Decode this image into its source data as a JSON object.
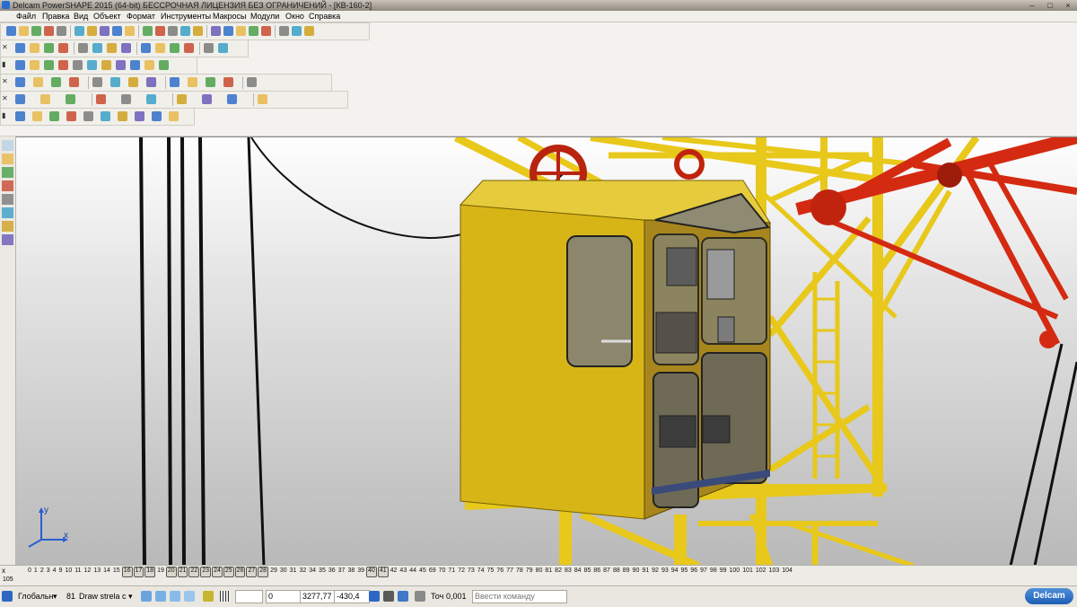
{
  "window": {
    "title": "Delcam PowerSHAPE 2015 (64-bit) БЕССРОЧНАЯ ЛИЦЕНЗИЯ БЕЗ ОГРАНИЧЕНИЙ - [КВ-160-2]",
    "minimize": "–",
    "maximize": "□",
    "close": "×"
  },
  "menu": [
    "Файл",
    "Правка",
    "Вид",
    "Объект",
    "Формат",
    "Инструменты",
    "Макросы",
    "Модули",
    "Окно",
    "Справка"
  ],
  "toolbars": {
    "row1": [
      "new-file-icon",
      "open-file-icon",
      "open-model-icon",
      "save-icon",
      "print-icon",
      "cut-icon",
      "copy-icon",
      "paste-icon",
      "erase-icon",
      "delete-icon",
      "undo-icon",
      "redo-icon",
      "select-icon",
      "wireframe-icon",
      "line-icon",
      "circle-icon",
      "curve-icon",
      "text-icon",
      "surface-icon",
      "solid-icon",
      "symbol-icon",
      "dimension-icon",
      "workplane-icon"
    ],
    "row1_colors": {
      "accent": "#2f6fc9",
      "active": "#a9c6ee"
    },
    "row2": [
      "view-iso-icon",
      "view-front-icon",
      "view-top-icon",
      "view-right-icon",
      "zoom-in-icon",
      "zoom-out-icon",
      "zoom-box-icon",
      "zoom-all-icon",
      "pan-icon",
      "rotate-icon",
      "shade-icon",
      "wireframe-view-icon",
      "light-icon",
      "material-icon"
    ],
    "row3": [
      "level-icon",
      "layer-icon",
      "colour-icon",
      "sphere-icon",
      "shade-smooth-icon",
      "arrow-green-icon",
      "cone-icon",
      "box-icon",
      "frame-icon",
      "block-icon",
      "texture-icon"
    ],
    "row4": [
      "curve-tools-icon",
      "surface-tools-icon",
      "fillet-icon",
      "blend-icon",
      "extrude-icon",
      "revolve-icon",
      "spine-icon",
      "sweep-icon",
      "loft-icon",
      "trim-icon",
      "limit-icon",
      "offset-icon",
      "edit-icon"
    ],
    "row5": [
      "solid-tools-icon",
      "boolean-icon",
      "feature-icon",
      "hole-icon",
      "chamfer-icon",
      "shell-icon",
      "draft-icon",
      "split-icon",
      "mirror-icon",
      "pattern-icon"
    ],
    "row6": [
      "render-icon",
      "axis-icon",
      "cube-icon",
      "cubes-icon",
      "block-stack-icon",
      "solid-cube-icon",
      "table-icon",
      "grid-icon",
      "palette-icon",
      "cone-render-icon"
    ]
  },
  "left_tools": [
    "pointer-icon",
    "axis-xy-icon",
    "axis-xyz-icon",
    "snap-icon",
    "measure-icon",
    "workplane-small-icon",
    "origin-icon",
    "star-icon"
  ],
  "viewport": {
    "axis_x": "x",
    "axis_y": "y",
    "colors": {
      "yellow": "#e8c81a",
      "dark_yellow": "#b8960a",
      "red": "#d42a12",
      "cabin": "#d7b517",
      "glass": "#8a8466"
    }
  },
  "layers": {
    "x_label": "x",
    "items": [
      {
        "n": "0",
        "on": false
      },
      {
        "n": "1",
        "on": false
      },
      {
        "n": "2",
        "on": false
      },
      {
        "n": "3",
        "on": false
      },
      {
        "n": "4",
        "on": false
      },
      {
        "n": "9",
        "on": false
      },
      {
        "n": "10",
        "on": false
      },
      {
        "n": "11",
        "on": false
      },
      {
        "n": "12",
        "on": false
      },
      {
        "n": "13",
        "on": false
      },
      {
        "n": "14",
        "on": false
      },
      {
        "n": "15",
        "on": false
      },
      {
        "n": "16",
        "on": true
      },
      {
        "n": "17",
        "on": true
      },
      {
        "n": "18",
        "on": true
      },
      {
        "n": "19",
        "on": false
      },
      {
        "n": "20",
        "on": true
      },
      {
        "n": "21",
        "on": true
      },
      {
        "n": "22",
        "on": true
      },
      {
        "n": "23",
        "on": true
      },
      {
        "n": "24",
        "on": true
      },
      {
        "n": "25",
        "on": true
      },
      {
        "n": "26",
        "on": true
      },
      {
        "n": "27",
        "on": true
      },
      {
        "n": "28",
        "on": true
      },
      {
        "n": "29",
        "on": false
      },
      {
        "n": "30",
        "on": false
      },
      {
        "n": "31",
        "on": false
      },
      {
        "n": "32",
        "on": false
      },
      {
        "n": "34",
        "on": false
      },
      {
        "n": "35",
        "on": false
      },
      {
        "n": "36",
        "on": false
      },
      {
        "n": "37",
        "on": false
      },
      {
        "n": "38",
        "on": false
      },
      {
        "n": "39",
        "on": false
      },
      {
        "n": "40",
        "on": true
      },
      {
        "n": "41",
        "on": true
      },
      {
        "n": "42",
        "on": false
      },
      {
        "n": "43",
        "on": false
      },
      {
        "n": "44",
        "on": false
      },
      {
        "n": "45",
        "on": false
      },
      {
        "n": "69",
        "on": false
      },
      {
        "n": "70",
        "on": false
      },
      {
        "n": "71",
        "on": false
      },
      {
        "n": "72",
        "on": false
      },
      {
        "n": "73",
        "on": false
      },
      {
        "n": "74",
        "on": false
      },
      {
        "n": "75",
        "on": false
      },
      {
        "n": "76",
        "on": false
      },
      {
        "n": "77",
        "on": false
      },
      {
        "n": "78",
        "on": false
      },
      {
        "n": "79",
        "on": false
      },
      {
        "n": "80",
        "on": false
      },
      {
        "n": "81",
        "on": false
      },
      {
        "n": "82",
        "on": false
      },
      {
        "n": "83",
        "on": false
      },
      {
        "n": "84",
        "on": false
      },
      {
        "n": "85",
        "on": false
      },
      {
        "n": "86",
        "on": false
      },
      {
        "n": "87",
        "on": false
      },
      {
        "n": "88",
        "on": false
      },
      {
        "n": "89",
        "on": false
      },
      {
        "n": "90",
        "on": false
      },
      {
        "n": "91",
        "on": false
      },
      {
        "n": "92",
        "on": false
      },
      {
        "n": "93",
        "on": false
      },
      {
        "n": "94",
        "on": false
      },
      {
        "n": "95",
        "on": false
      },
      {
        "n": "96",
        "on": false
      },
      {
        "n": "97",
        "on": false
      },
      {
        "n": "98",
        "on": false
      },
      {
        "n": "99",
        "on": false
      },
      {
        "n": "100",
        "on": false
      },
      {
        "n": "101",
        "on": false
      },
      {
        "n": "102",
        "on": false
      },
      {
        "n": "103",
        "on": false
      },
      {
        "n": "104",
        "on": false
      }
    ],
    "extra": "105"
  },
  "status": {
    "workplane": "Глобальн",
    "level_num": "81",
    "level_name": "Draw strela c",
    "x_value": "0",
    "y_value": "3277,77",
    "z_value": "-430,4",
    "tol_label": "Точ",
    "tol_value": "0,001",
    "command_placeholder": "Ввести команду",
    "logo": "Delcam"
  }
}
